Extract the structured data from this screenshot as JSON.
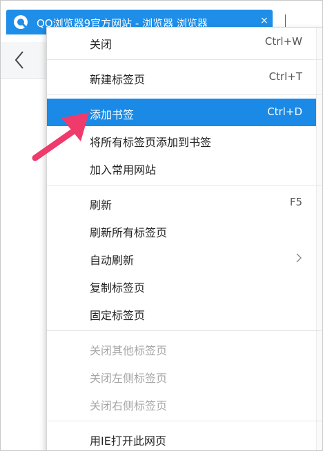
{
  "tab": {
    "title": "QQ浏览器9官方网站 - 浏览器  浏览器",
    "close_glyph": "×"
  },
  "toolbar": {
    "back_glyph": "<"
  },
  "menu": {
    "groups": [
      [
        {
          "label": "关闭",
          "shortcut": "Ctrl+W"
        }
      ],
      [
        {
          "label": "新建标签页",
          "shortcut": "Ctrl+T"
        }
      ],
      [
        {
          "label": "添加书签",
          "shortcut": "Ctrl+D",
          "highlighted": true
        },
        {
          "label": "将所有标签页添加到书签"
        },
        {
          "label": "加入常用网站"
        }
      ],
      [
        {
          "label": "刷新",
          "shortcut": "F5"
        },
        {
          "label": "刷新所有标签页"
        },
        {
          "label": "自动刷新",
          "submenu": true
        },
        {
          "label": "复制标签页"
        },
        {
          "label": "固定标签页"
        }
      ],
      [
        {
          "label": "关闭其他标签页",
          "disabled": true
        },
        {
          "label": "关闭左侧标签页",
          "disabled": true
        },
        {
          "label": "关闭右侧标签页",
          "disabled": true
        }
      ],
      [
        {
          "label": "用IE打开此网页"
        }
      ]
    ]
  },
  "colors": {
    "accent": "#1a8ae6",
    "tab": "#1e8ee8",
    "annotation_arrow": "#ef3a6c"
  }
}
